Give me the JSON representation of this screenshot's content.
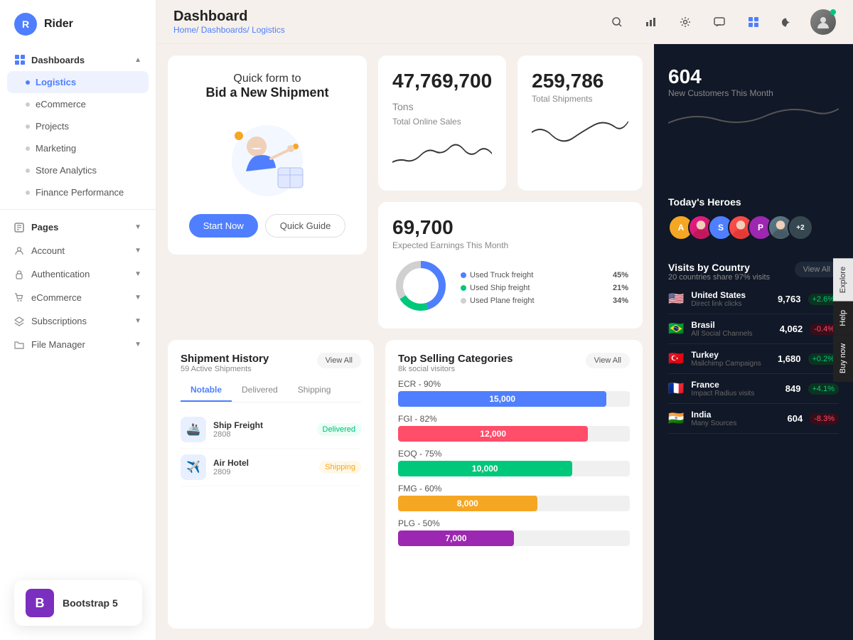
{
  "app": {
    "logo_letter": "R",
    "logo_name": "Rider"
  },
  "sidebar": {
    "dashboards_label": "Dashboards",
    "nav_items": [
      {
        "label": "Logistics",
        "active": true
      },
      {
        "label": "eCommerce",
        "active": false
      },
      {
        "label": "Projects",
        "active": false
      },
      {
        "label": "Marketing",
        "active": false
      },
      {
        "label": "Store Analytics",
        "active": false
      },
      {
        "label": "Finance Performance",
        "active": false
      }
    ],
    "pages_label": "Pages",
    "page_items": [
      {
        "label": "Account",
        "icon": "person"
      },
      {
        "label": "Authentication",
        "icon": "lock"
      },
      {
        "label": "eCommerce",
        "icon": "cart"
      },
      {
        "label": "Subscriptions",
        "icon": "layers"
      },
      {
        "label": "File Manager",
        "icon": "folder"
      }
    ]
  },
  "topbar": {
    "title": "Dashboard",
    "breadcrumb_home": "Home/",
    "breadcrumb_dashboards": "Dashboards/",
    "breadcrumb_current": "Logistics"
  },
  "promo_card": {
    "line1": "Quick form to",
    "line2": "Bid a New Shipment",
    "btn_primary": "Start Now",
    "btn_secondary": "Quick Guide"
  },
  "total_sales": {
    "number": "47,769,700",
    "unit": "Tons",
    "label": "Total Online Sales"
  },
  "total_shipments": {
    "number": "259,786",
    "label": "Total Shipments"
  },
  "earnings": {
    "number": "69,700",
    "label": "Expected Earnings This Month",
    "legend": [
      {
        "label": "Used Truck freight",
        "color": "#4f7fff",
        "value": "45%"
      },
      {
        "label": "Used Ship freight",
        "color": "#00c87a",
        "value": "21%"
      },
      {
        "label": "Used Plane freight",
        "color": "#d0d0d0",
        "value": "34%"
      }
    ]
  },
  "new_customers": {
    "number": "604",
    "label": "New Customers This Month"
  },
  "heroes": {
    "title": "Today's Heroes",
    "avatars": [
      {
        "color": "#f5a623",
        "letter": "A"
      },
      {
        "color": "#e91e8c",
        "letter": ""
      },
      {
        "color": "#4f7fff",
        "letter": "S"
      },
      {
        "color": "#ff5252",
        "letter": ""
      },
      {
        "color": "#9c27b0",
        "letter": "P"
      },
      {
        "color": "#607d8b",
        "letter": ""
      },
      {
        "color": "#455a64",
        "letter": "+2"
      }
    ]
  },
  "shipment_history": {
    "title": "Shipment History",
    "subtitle": "59 Active Shipments",
    "view_all": "View All",
    "tabs": [
      "Notable",
      "Delivered",
      "Shipping"
    ],
    "items": [
      {
        "name": "Ship Freight",
        "id": "2808",
        "status": "Delivered",
        "status_class": "status-delivered"
      },
      {
        "name": "Air Hotel",
        "id": "2809",
        "status": "Shipping",
        "status_class": "status-shipping"
      }
    ]
  },
  "categories": {
    "title": "Top Selling Categories",
    "subtitle": "8k social visitors",
    "view_all": "View All",
    "items": [
      {
        "label": "ECR - 90%",
        "value": "15,000",
        "width": "90",
        "color": "#4f7fff"
      },
      {
        "label": "FGI - 82%",
        "value": "12,000",
        "width": "82",
        "color": "#ff4d6a"
      },
      {
        "label": "EOQ - 75%",
        "value": "10,000",
        "width": "75",
        "color": "#00c87a"
      },
      {
        "label": "FMG - 60%",
        "value": "8,000",
        "width": "60",
        "color": "#f5a623"
      },
      {
        "label": "PLG - 50%",
        "value": "7,000",
        "width": "50",
        "color": "#9c27b0"
      }
    ]
  },
  "visits_by_country": {
    "title": "Visits by Country",
    "subtitle": "20 countries share 97% visits",
    "view_all": "View All",
    "countries": [
      {
        "flag": "🇺🇸",
        "name": "United States",
        "source": "Direct link clicks",
        "visits": "9,763",
        "change": "+2.6%",
        "up": true
      },
      {
        "flag": "🇧🇷",
        "name": "Brasil",
        "source": "All Social Channels",
        "visits": "4,062",
        "change": "-0.4%",
        "up": false
      },
      {
        "flag": "🇹🇷",
        "name": "Turkey",
        "source": "Mailchimp Campaigns",
        "visits": "1,680",
        "change": "+0.2%",
        "up": true
      },
      {
        "flag": "🇫🇷",
        "name": "France",
        "source": "Impact Radius visits",
        "visits": "849",
        "change": "+4.1%",
        "up": true
      },
      {
        "flag": "🇮🇳",
        "name": "India",
        "source": "Many Sources",
        "visits": "604",
        "change": "-8.3%",
        "up": false
      }
    ]
  },
  "side_tabs": [
    "Explore",
    "Help",
    "Buy now"
  ]
}
